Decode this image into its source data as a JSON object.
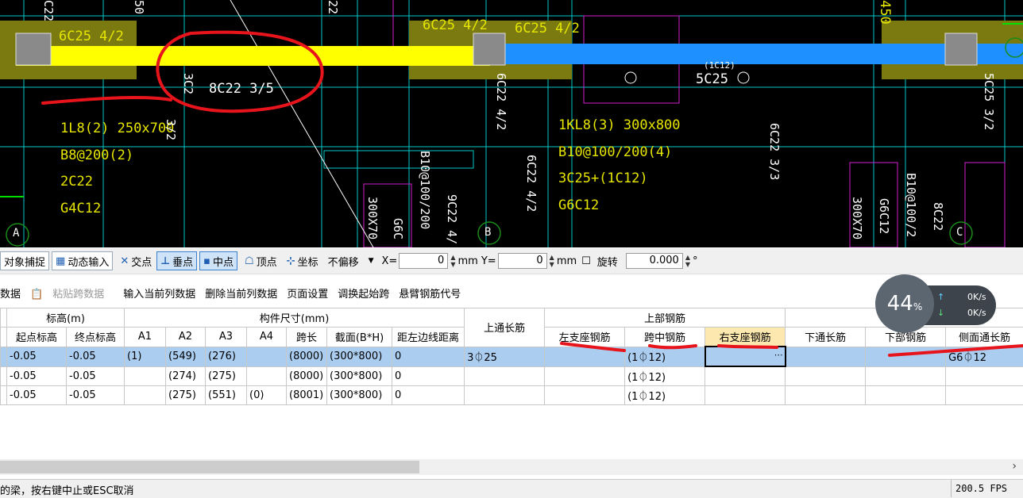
{
  "cad": {
    "texts_yellow": [
      "6C25 4/2",
      "6C25 4/2",
      "6C25 4/2",
      "1L8(2) 250x700",
      "B8@200(2)",
      "2C22",
      "G4C12",
      "1KL8(3) 300x800",
      "B10@100/200(4)",
      "3C25+(1C12)",
      "G6C12"
    ],
    "texts_white": [
      "8C22 3/5",
      "5C25",
      "(1C12)"
    ],
    "texts_vertical": [
      "6C22 4/2",
      "6C22 4/2",
      "6C22 3/3",
      "B10@100/200",
      "9C22 4/",
      "300X70",
      "G6C",
      "300X70",
      "G6C12",
      "B10@100/2",
      "8C22",
      "5C25 3/2",
      "3C2",
      "450",
      "C22",
      "50",
      "22",
      "3/2"
    ],
    "axis_labels": [
      "A",
      "B",
      "C"
    ]
  },
  "snap": {
    "obj_snap": "对象捕捉",
    "dyn_input": "动态输入",
    "intersect": "交点",
    "perp": "垂点",
    "mid": "中点",
    "vertex": "顶点",
    "coord": "坐标",
    "offset": "不偏移",
    "x_label": "X=",
    "x_value": "0",
    "unit1": "mm",
    "y_label": "Y=",
    "y_value": "0",
    "unit2": "mm",
    "rotate": "旋转",
    "rotate_value": "0.000",
    "deg": "°"
  },
  "menu": [
    "数据",
    "粘贴跨数据",
    "输入当前列数据",
    "删除当前列数据",
    "页面设置",
    "调换起始跨",
    "悬臂钢筋代号"
  ],
  "table": {
    "group_headers": {
      "elev": "标高(m)",
      "dims": "构件尺寸(mm)",
      "top": "上部钢筋",
      "bottom": "下部钢筋"
    },
    "headers": [
      "起点标高",
      "终点标高",
      "A1",
      "A2",
      "A3",
      "A4",
      "跨长",
      "截面(B*H)",
      "距左边线距离",
      "上通长筋",
      "左支座钢筋",
      "跨中钢筋",
      "右支座钢筋",
      "下通长筋",
      "下部钢筋",
      "侧面通长筋"
    ],
    "rows": [
      [
        "-0.05",
        "-0.05",
        "(1)",
        "(549)",
        "(276)",
        "",
        "(8000)",
        "(300*800)",
        "0",
        "3⏀25",
        "",
        "(1⏀12)",
        "",
        "",
        "",
        "G6⏀12"
      ],
      [
        "-0.05",
        "-0.05",
        "",
        "(274)",
        "(275)",
        "",
        "(8000)",
        "(300*800)",
        "0",
        "",
        "",
        "(1⏀12)",
        "",
        "",
        "",
        ""
      ],
      [
        "-0.05",
        "-0.05",
        "",
        "(275)",
        "(551)",
        "(0)",
        "(8001)",
        "(300*800)",
        "0",
        "",
        "",
        "(1⏀12)",
        "",
        "",
        "",
        ""
      ]
    ]
  },
  "network": {
    "percent": "44",
    "percent_unit": "%",
    "up": "0K/s",
    "down": "0K/s"
  },
  "status": {
    "message": "的梁，按右键中止或ESC取消",
    "fps": "200.5 FPS"
  },
  "colors": {
    "cad_bg": "#000000",
    "beam_yellow": "#ffff00",
    "beam_blue": "#1e90ff",
    "column_olive": "#7a7a10",
    "selected_row": "#abcdf0",
    "annotation_red": "#e8141c"
  }
}
